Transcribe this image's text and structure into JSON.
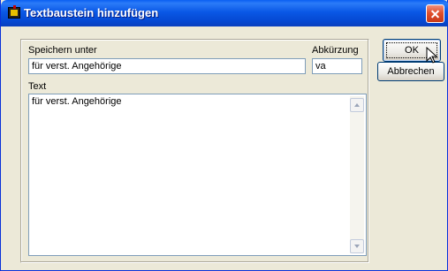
{
  "window": {
    "title": "Textbaustein hinzufügen",
    "icon": "app-icon",
    "close_icon": "close-icon"
  },
  "form": {
    "save_under_label": "Speichern unter",
    "save_under_value": "für verst. Angehörige",
    "abbreviation_label": "Abkürzung",
    "abbreviation_value": "va",
    "text_label": "Text",
    "text_value": "für verst. Angehörige"
  },
  "buttons": {
    "ok_label": "OK",
    "cancel_label": "Abbrechen"
  },
  "colors": {
    "titlebar": "#0a58e6",
    "window_bg": "#ece9d8",
    "field_border": "#7f9db9",
    "close_button": "#e0502c"
  }
}
